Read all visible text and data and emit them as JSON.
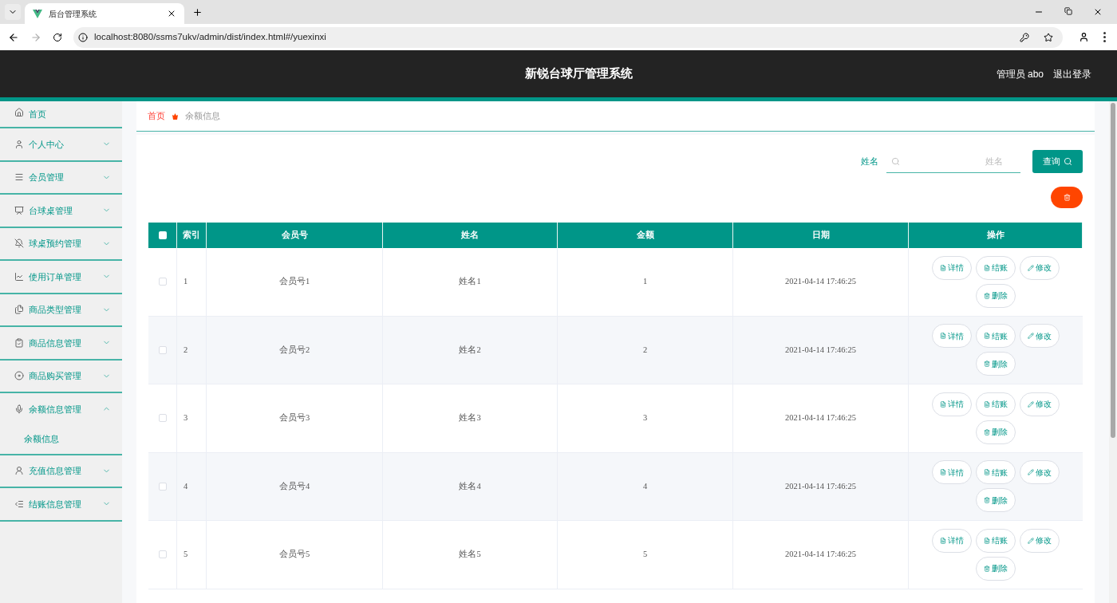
{
  "browser": {
    "tab_title": "后台管理系统",
    "url": "localhost:8080/ssms7ukv/admin/dist/index.html#/yuexinxi"
  },
  "header": {
    "title": "新锐台球厅管理系统",
    "user": "管理员 abo",
    "logout": "退出登录"
  },
  "sidebar": {
    "items": [
      {
        "kind": "link",
        "label": "首页"
      },
      {
        "kind": "menu",
        "label": "个人中心",
        "expanded": false
      },
      {
        "kind": "menu",
        "label": "会员管理",
        "expanded": false
      },
      {
        "kind": "menu",
        "label": "台球桌管理",
        "expanded": false
      },
      {
        "kind": "menu",
        "label": "球桌预约管理",
        "expanded": false
      },
      {
        "kind": "menu",
        "label": "使用订单管理",
        "expanded": false
      },
      {
        "kind": "menu",
        "label": "商品类型管理",
        "expanded": false
      },
      {
        "kind": "menu",
        "label": "商品信息管理",
        "expanded": false
      },
      {
        "kind": "menu",
        "label": "商品购买管理",
        "expanded": false
      },
      {
        "kind": "menu",
        "label": "余额信息管理",
        "expanded": true,
        "children": [
          {
            "label": "余额信息",
            "selected": true
          }
        ]
      },
      {
        "kind": "menu",
        "label": "充值信息管理",
        "expanded": false
      },
      {
        "kind": "menu",
        "label": "结账信息管理",
        "expanded": false
      }
    ]
  },
  "breadcrumb": [
    "首页",
    "余额信息"
  ],
  "search": {
    "label": "姓名",
    "placeholder": "姓名",
    "button": "查询"
  },
  "table": {
    "columns": [
      "索引",
      "会员号",
      "姓名",
      "金额",
      "日期",
      "操作"
    ],
    "all_checked": false,
    "rows": [
      {
        "checked": false,
        "cells": [
          "1",
          "会员号1",
          "姓名1",
          "1",
          "2021-04-14 17:46:25"
        ],
        "actions": [
          "详情",
          "结账",
          "修改",
          "删除"
        ]
      },
      {
        "checked": false,
        "cells": [
          "2",
          "会员号2",
          "姓名2",
          "2",
          "2021-04-14 17:46:25"
        ],
        "actions": [
          "详情",
          "结账",
          "修改",
          "删除"
        ]
      },
      {
        "checked": false,
        "cells": [
          "3",
          "会员号3",
          "姓名3",
          "3",
          "2021-04-14 17:46:25"
        ],
        "actions": [
          "详情",
          "结账",
          "修改",
          "删除"
        ]
      },
      {
        "checked": false,
        "cells": [
          "4",
          "会员号4",
          "姓名4",
          "4",
          "2021-04-14 17:46:25"
        ],
        "actions": [
          "详情",
          "结账",
          "修改",
          "删除"
        ]
      },
      {
        "checked": false,
        "cells": [
          "5",
          "会员号5",
          "姓名5",
          "5",
          "2021-04-14 17:46:25"
        ],
        "actions": [
          "详情",
          "结账",
          "修改",
          "删除"
        ]
      }
    ]
  }
}
